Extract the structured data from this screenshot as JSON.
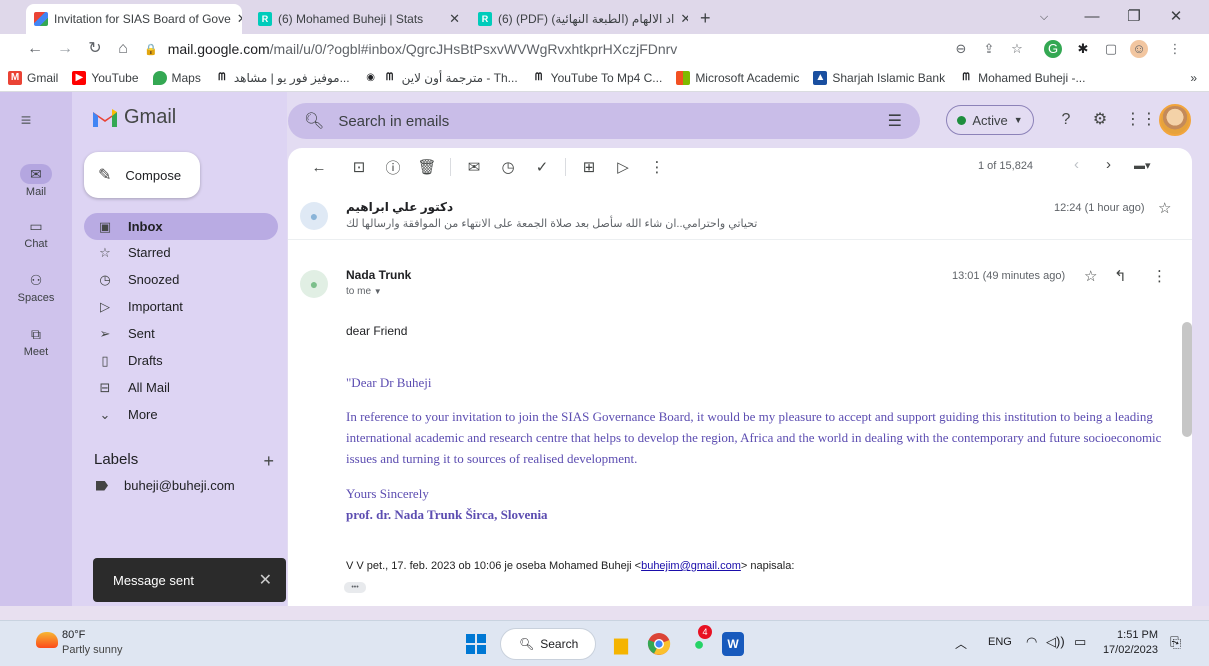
{
  "browser": {
    "tabs": [
      {
        "label": "Invitation for SIAS Board of Gove",
        "icon": "gmail-icon",
        "active": true
      },
      {
        "label": "(6) Mohamed Buheji | Stats",
        "icon": "researchgate-icon"
      },
      {
        "label": "(6) (PDF) (الطبعة النهائية) اد الالهام",
        "icon": "researchgate-icon"
      }
    ],
    "new_tab": "+",
    "url_host": "mail.google.com",
    "url_path": "/mail/u/0/?ogbl#inbox/QgrcJHsBtPsxvWVWgRvxhtkprHXczjFDnrv",
    "bookmarks": [
      {
        "label": "Gmail",
        "icon": "gmail-icon",
        "color": "#ea4335"
      },
      {
        "label": "YouTube",
        "icon": "youtube-icon",
        "color": "#ff0000"
      },
      {
        "label": "Maps",
        "icon": "maps-icon",
        "color": "#34a853"
      },
      {
        "label": "موفيز فور يو | مشاهد...",
        "icon": "site-icon",
        "color": "#202124"
      },
      {
        "label": "مترجمة أون لاين - Th...",
        "icon": "site-icon",
        "color": "#202124"
      },
      {
        "label": "YouTube To Mp4 C...",
        "icon": "site-icon",
        "color": "#202124"
      },
      {
        "label": "Microsoft Academic",
        "icon": "microsoft-icon",
        "color": "#f25022"
      },
      {
        "label": "Sharjah Islamic Bank",
        "icon": "bank-icon",
        "color": "#1a4fa0"
      },
      {
        "label": "Mohamed Buheji -...",
        "icon": "site-icon",
        "color": "#202124"
      }
    ],
    "more_bookmarks": "»"
  },
  "gmail": {
    "logo_text": "Gmail",
    "compose_label": "Compose",
    "rail": [
      {
        "label": "Mail",
        "icon": "mail-icon"
      },
      {
        "label": "Chat",
        "icon": "chat-icon"
      },
      {
        "label": "Spaces",
        "icon": "spaces-icon"
      },
      {
        "label": "Meet",
        "icon": "meet-icon"
      }
    ],
    "nav": [
      {
        "label": "Inbox",
        "icon": "inbox-icon",
        "selected": true
      },
      {
        "label": "Starred",
        "icon": "star-icon"
      },
      {
        "label": "Snoozed",
        "icon": "clock-icon"
      },
      {
        "label": "Important",
        "icon": "important-icon"
      },
      {
        "label": "Sent",
        "icon": "send-icon"
      },
      {
        "label": "Drafts",
        "icon": "draft-icon"
      },
      {
        "label": "All Mail",
        "icon": "allmail-icon"
      },
      {
        "label": "More",
        "icon": "chevron-down-icon"
      }
    ],
    "labels_heading": "Labels",
    "labels": [
      {
        "label": "buheji@buheji.com",
        "icon": "label-icon"
      }
    ],
    "search_placeholder": "Search in emails",
    "status_label": "Active",
    "pager": "1 of 15,824",
    "toast": "Message sent"
  },
  "thread": {
    "collapsed": {
      "sender": "دكتور علي ابراهيم",
      "snippet": "تحياتي واحترامي..ان شاء الله سأصل بعد صلاة الجمعة على الانتهاء من الموافقة وارسالها لك",
      "time": "12:24 (1 hour ago)"
    },
    "open": {
      "sender": "Nada Trunk",
      "to": "to me",
      "time": "13:01 (49 minutes ago)",
      "greeting": "dear Friend",
      "quote_open": "\"Dear Dr Buheji",
      "paragraph": "In reference to your invitation to join the SIAS Governance Board, it would be my pleasure to accept and support guiding this institution to being a leading international academic and research centre that helps to develop the region, Africa and the world in dealing with the contemporary and future socioeconomic issues and turning it to sources of realised development.",
      "closing": "Yours Sincerely",
      "signature": "prof. dr. Nada Trunk Širca, Slovenia",
      "reply_line_prefix": "V V pet., 17. feb. 2023 ob 10:06 je oseba Mohamed Buheji <",
      "reply_line_email": "buhejim@gmail.com",
      "reply_line_suffix": "> napisala:",
      "ellipsis": "•••"
    }
  },
  "taskbar": {
    "weather_temp": "80°F",
    "weather_desc": "Partly sunny",
    "search_label": "Search",
    "whatsapp_badge": "4",
    "lang": "ENG",
    "time": "1:51 PM",
    "date": "17/02/2023"
  }
}
